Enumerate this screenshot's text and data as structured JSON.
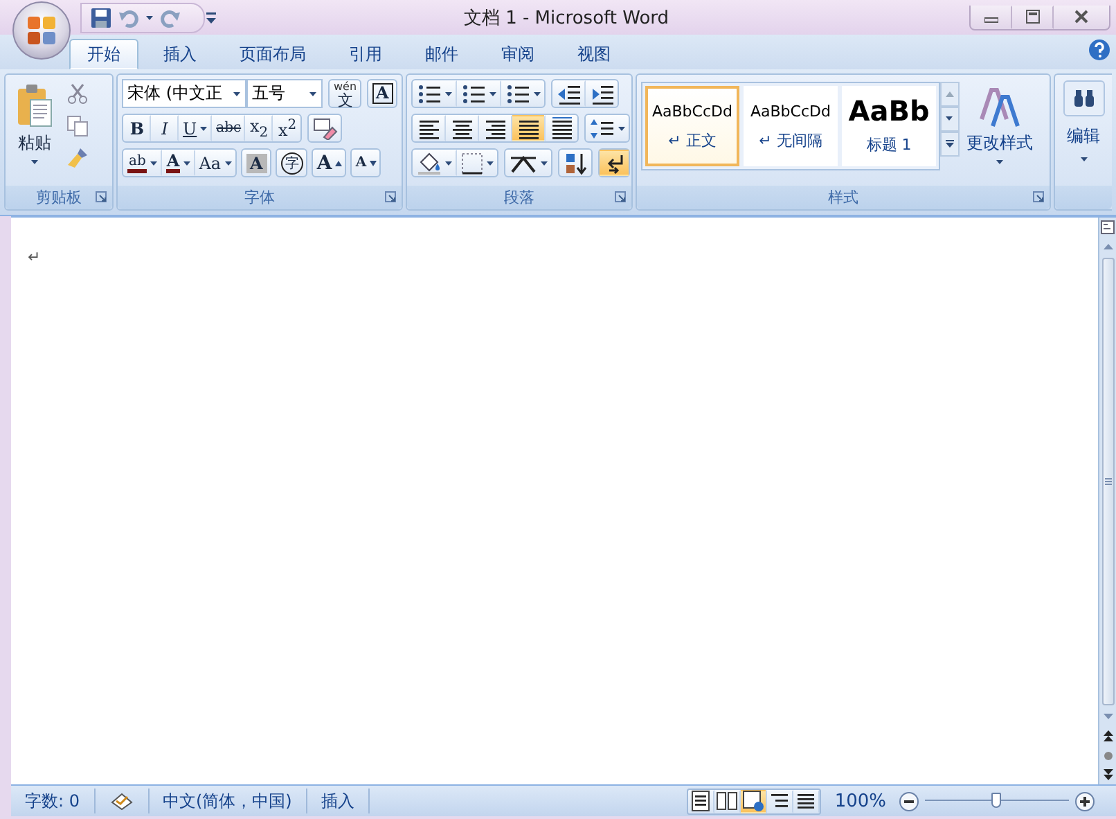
{
  "window": {
    "title": "文档 1 - Microsoft Word"
  },
  "tabs": [
    {
      "label": "开始",
      "selected": true
    },
    {
      "label": "插入",
      "selected": false
    },
    {
      "label": "页面布局",
      "selected": false
    },
    {
      "label": "引用",
      "selected": false
    },
    {
      "label": "邮件",
      "selected": false
    },
    {
      "label": "审阅",
      "selected": false
    },
    {
      "label": "视图",
      "selected": false
    }
  ],
  "clipboard": {
    "paste_label": "粘贴",
    "group_label": "剪贴板"
  },
  "font": {
    "font_name": "宋体 (中文正",
    "font_size": "五号",
    "phonetic": {
      "ruby": "wén",
      "base": "文"
    },
    "border_button": "A",
    "format_buttons": [
      {
        "label": "B",
        "kind": "bold"
      },
      {
        "label": "I",
        "kind": "italic"
      },
      {
        "label": "U",
        "kind": "underline"
      },
      {
        "label": "abc",
        "kind": "strike"
      },
      {
        "label": "x$_{2}$",
        "kind": "sub"
      },
      {
        "label": "x$^{2}$",
        "kind": "sup"
      }
    ],
    "effect_buttons": [
      {
        "label": "ab",
        "kind": "highlight"
      },
      {
        "label": "A",
        "kind": "font_color"
      },
      {
        "label": "Aa",
        "kind": "case"
      },
      {
        "label": "A",
        "kind": "shading"
      },
      {
        "label": "字",
        "kind": "enclose"
      },
      {
        "label": "A",
        "kind": "grow"
      },
      {
        "label": "A",
        "kind": "shrink"
      }
    ],
    "group_label": "字体"
  },
  "paragraph": {
    "alignment": [
      {
        "kind": "left",
        "selected": false
      },
      {
        "kind": "center",
        "selected": false
      },
      {
        "kind": "right",
        "selected": false
      },
      {
        "kind": "justify",
        "selected": true
      },
      {
        "kind": "distributed",
        "selected": false
      }
    ],
    "show_marks": {
      "selected": true
    },
    "group_label": "段落"
  },
  "styles": {
    "items": [
      {
        "sample": "AaBbCcDd",
        "para_mark": "↵",
        "name": "正文",
        "kind": "body",
        "selected": true
      },
      {
        "sample": "AaBbCcDd",
        "para_mark": "↵",
        "name": "无间隔",
        "kind": "body",
        "selected": false
      },
      {
        "sample": "AaBb",
        "name": "标题 1",
        "kind": "heading",
        "selected": false
      }
    ],
    "change_styles": "更改样式",
    "group_label": "样式"
  },
  "editing": {
    "label": "编辑"
  },
  "document": {
    "paragraph_mark": "↵"
  },
  "status": {
    "word_count": "字数: 0",
    "language": "中文(简体，中国)",
    "mode": "插入",
    "views": [
      {
        "kind": "print",
        "selected": false
      },
      {
        "kind": "reading",
        "selected": false
      },
      {
        "kind": "web",
        "selected": true
      },
      {
        "kind": "outline",
        "selected": false
      },
      {
        "kind": "draft",
        "selected": false
      }
    ],
    "zoom": {
      "reading": "100%",
      "level": 0.5
    }
  }
}
